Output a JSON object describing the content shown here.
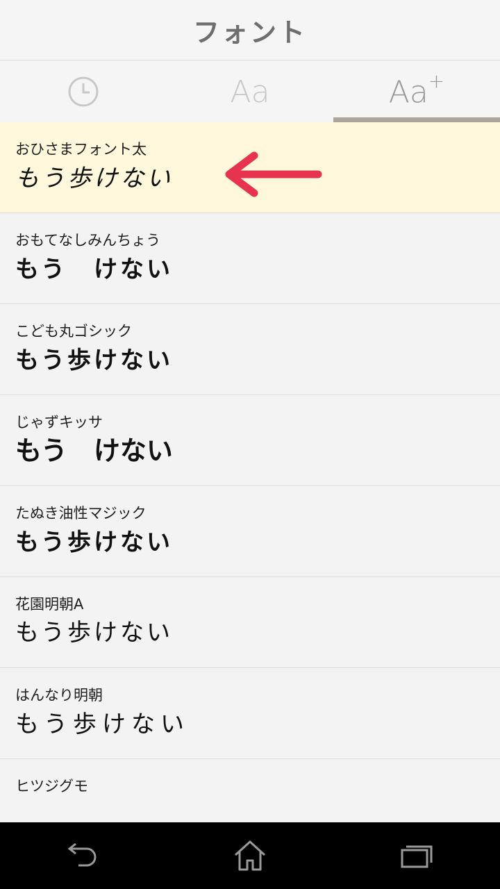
{
  "header": {
    "title": "フォント"
  },
  "tabs": [
    {
      "icon": "clock-icon",
      "label": ""
    },
    {
      "icon": "font-icon",
      "label": "Aa"
    },
    {
      "icon": "font-add-icon",
      "label": "Aa",
      "suffix": "+"
    }
  ],
  "fonts": [
    {
      "name": "おひさまフォント太",
      "sample": "もう歩けない"
    },
    {
      "name": "おもてなしみんちょう",
      "sample": "もう　けない"
    },
    {
      "name": "こども丸ゴシック",
      "sample": "もう歩けない"
    },
    {
      "name": "じゃずキッサ",
      "sample": "もう　けない"
    },
    {
      "name": "たぬき油性マジック",
      "sample": "もう歩けない"
    },
    {
      "name": "花園明朝A",
      "sample": "もう歩けない"
    },
    {
      "name": "はんなり明朝",
      "sample": "もう歩けない"
    },
    {
      "name": "ヒツジグモ",
      "sample": ""
    }
  ],
  "navbar": {
    "back": "back-icon",
    "home": "home-icon",
    "recents": "recents-icon"
  },
  "colors": {
    "selected_bg": "#fff8dc",
    "arrow": "#e8334f",
    "tab_indicator": "#a9a59c"
  }
}
